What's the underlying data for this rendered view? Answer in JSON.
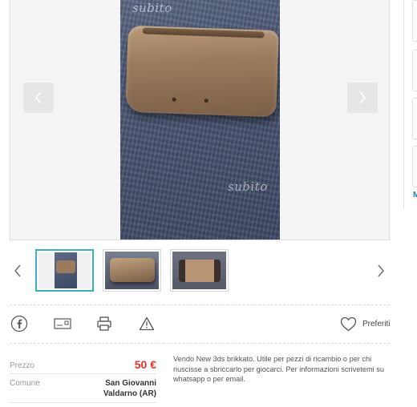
{
  "gallery": {
    "watermark": "subito",
    "nav_prev_icon": "chevron-left-icon",
    "nav_next_icon": "chevron-right-icon"
  },
  "sidebar": {
    "link_initial": "M"
  },
  "thumbnails": {
    "count": 3,
    "active_index": 0,
    "prev_icon": "chevron-left-icon",
    "next_icon": "chevron-right-icon"
  },
  "actions": {
    "icons": [
      "facebook-icon",
      "email-icon",
      "print-icon",
      "warning-icon"
    ],
    "favorites_label": "Preferiti",
    "favorites_icon": "heart-icon"
  },
  "details": {
    "price_label": "Prezzo",
    "price_value": "50 €",
    "comune_label": "Comune",
    "comune_value_line1": "San Giovanni",
    "comune_value_line2": "Valdarno (AR)"
  },
  "description": "Vendo New 3ds brikkato. Utile per pezzi di ricambio o per chi riuscisse a sbriccarlo per giocarci. Per informazioni scrivetemi su whatsapp o per email.",
  "colors": {
    "accent": "#3bb1b8",
    "price": "#e0332d",
    "link": "#1c7ea7"
  }
}
